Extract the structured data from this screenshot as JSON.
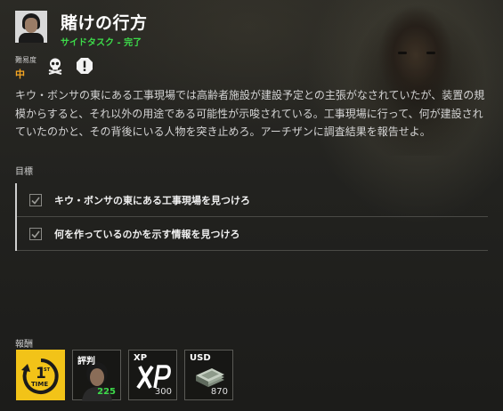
{
  "mission": {
    "title": "賭けの行方",
    "subtitle": "サイドタスク - 完了",
    "difficulty_label": "難易度",
    "difficulty_value": "中",
    "icons": [
      "skull-crossbones-icon",
      "warning-exclamation-icon"
    ],
    "description": "キウ・ボンサの東にある工事現場では高齢者施設が建設予定との主張がなされていたが、装置の規模からすると、それ以外の用途である可能性が示唆されている。工事現場に行って、何が建設されていたのかと、その背後にいる人物を突き止めろ。アーチザンに調査結果を報告せよ。"
  },
  "objectives": {
    "label": "目標",
    "items": [
      {
        "text": "キウ・ボンサの東にある工事現場を見つけろ",
        "completed": true
      },
      {
        "text": "何を作っているのかを示す情報を見つけろ",
        "completed": true
      }
    ]
  },
  "rewards": {
    "label": "報酬",
    "items": [
      {
        "icon": "first-time-icon",
        "label": "",
        "value": ""
      },
      {
        "icon": "reputation-portrait-icon",
        "label": "評判",
        "value": "225"
      },
      {
        "icon": "xp-icon",
        "label": "XP",
        "value": "300"
      },
      {
        "icon": "cash-stack-icon",
        "label": "USD",
        "value": "870"
      }
    ]
  },
  "colors": {
    "accent_green": "#3ddb4a",
    "difficulty_orange": "#f5a623",
    "first_time_yellow": "#f2c318"
  }
}
